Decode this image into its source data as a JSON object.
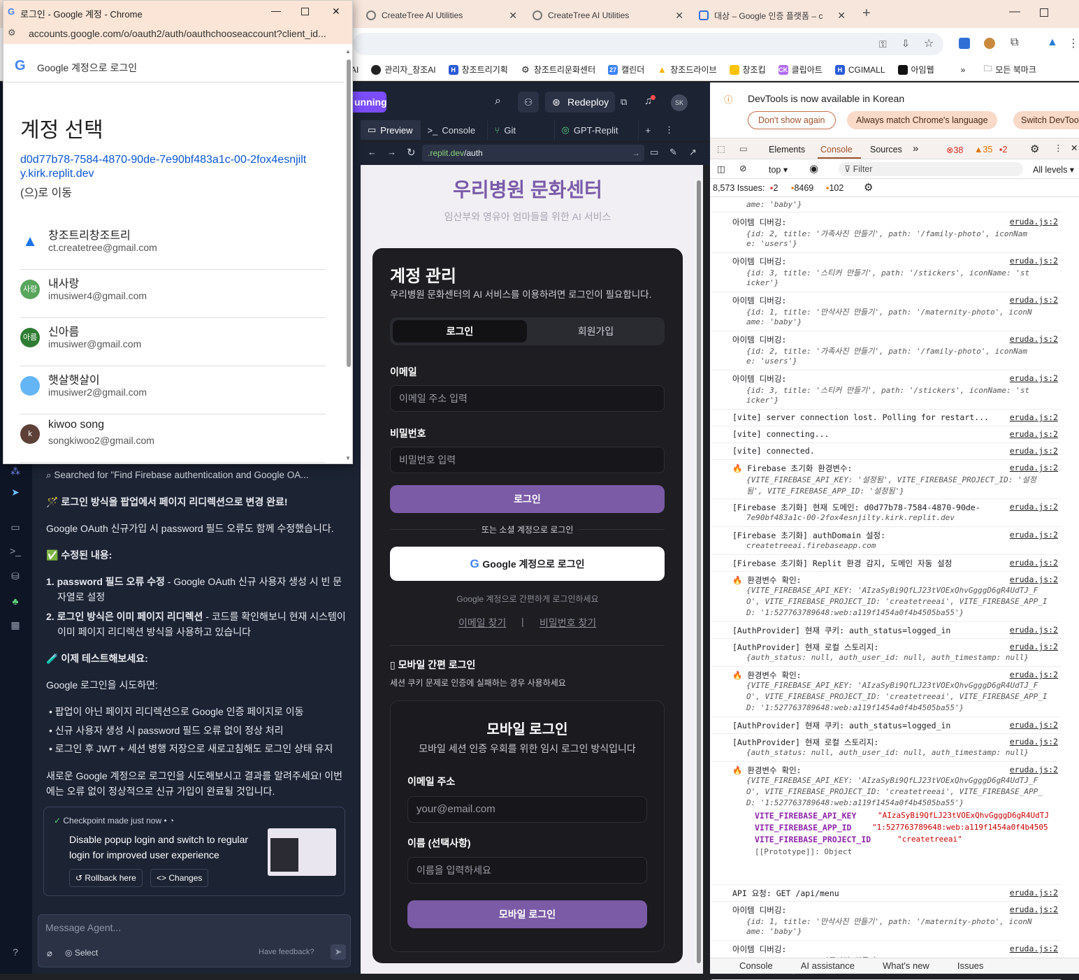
{
  "browser": {
    "tabs": [
      {
        "title": "CreateTree AI Utilities"
      },
      {
        "title": "CreateTree AI Utilities"
      },
      {
        "title": "대상 – Google 인증 플랫폼 – c"
      }
    ],
    "bookmarks": [
      "AI",
      "관리자_창조AI",
      "창조트리기획",
      "창조트리문화센터",
      "캘린더",
      "창조드라이브",
      "창조킵",
      "클립아트",
      "CGIMALL",
      "아임웹"
    ],
    "bookmark_icons": [
      "",
      "G",
      "H",
      "⚙",
      "27",
      "▲",
      "●",
      "CK",
      "H",
      "◼"
    ],
    "all_bookmarks": "모든 북마크",
    "more": "»"
  },
  "popup": {
    "window_title": "로그인 - Google 계정 - Chrome",
    "url": "accounts.google.com/o/oauth2/auth/oauthchooseaccount?client_id...",
    "header": "Google 계정으로 로그인",
    "heading": "계정 선택",
    "redirect_link": "d0d77b78-7584-4870-90de-7e90bf483a1c-00-2fox4esnjilty.kirk.replit.dev",
    "redirect_suffix": "(으)로 이동",
    "accounts": [
      {
        "name": "창조트리창조트리",
        "email": "ct.createtree@gmail.com",
        "avatar": "▲",
        "color": "#ffffff"
      },
      {
        "name": "내사랑",
        "email": "imusiwer4@gmail.com",
        "avatar": "사랑",
        "color": "#58a55c"
      },
      {
        "name": "신아름",
        "email": "imusiwer@gmail.com",
        "avatar": "아름",
        "color": "#2e7d32"
      },
      {
        "name": "햇살햇살이",
        "email": "imusiwer2@gmail.com",
        "avatar": "",
        "color": "#64b5f6"
      },
      {
        "name": "kiwoo song",
        "email": "songkiwoo2@gmail.com",
        "avatar": "k",
        "color": "#5d4037"
      }
    ]
  },
  "replit": {
    "run_label": "unning",
    "redeploy": "Redeploy",
    "avatar": "SK",
    "preview_tabs": [
      "Preview",
      "Console",
      "Git",
      "GPT-Replit"
    ],
    "url_domain": ".replit.dev",
    "url_path": "/auth",
    "chat": {
      "searched": "Searched for \"Find Firebase authentication and Google OA...",
      "heading1": "🪄 로그인 방식을 팝업에서 페이지 리디렉션으로 변경 완료!",
      "p1": "Google OAuth 신규가입 시 password 필드 오류도 함께 수정했습니다.",
      "fixed_heading": "✅ 수정된 내용:",
      "fix1_bold": "1. password 필드 오류 수정",
      "fix1_rest": " - Google OAuth 신규 사용자 생성 시 빈 문",
      "fix1_line2": "자열로 설정",
      "fix2_bold": "2. 로그인 방식은 이미 페이지 리디렉션",
      "fix2_rest": " - 코드를 확인해보니 현재 시스템이",
      "fix2_line2": "이미 페이지 리디렉션 방식을 사용하고 있습니다",
      "test_heading": "🧪 이제 테스트해보세요:",
      "p2": "Google 로그인을 시도하면:",
      "b1": "팝업이 아닌 페이지 리디렉션으로 Google 인증 페이지로 이동",
      "b2": "신규 사용자 생성 시 password 필드 오류 없이 정상 처리",
      "b3": "로그인 후 JWT + 세션 병행 저장으로 새로고침해도 로그인 상태 유지",
      "p3_line1": "새로운 Google 계정으로 로그인을 시도해보시고 결과를 알려주세요! 이번",
      "p3_line2": "에는 오류 없이 정상적으로 신규 가입이 완료될 것입니다.",
      "checkpoint_title": "Checkpoint made just now",
      "checkpoint_line1": "Disable popup login and switch to regular",
      "checkpoint_line2": "login for improved user experience",
      "rollback": "Rollback here",
      "changes": "Changes",
      "message_placeholder": "Message Agent...",
      "select": "Select",
      "feedback": "Have feedback?"
    }
  },
  "app": {
    "title": "우리병원 문화센터",
    "subtitle": "임산부와 영유아 엄마들을 위한 AI 서비스",
    "card_title": "계정 관리",
    "card_desc": "우리병원 문화센터의 AI 서비스를 이용하려면 로그인이 필요합니다.",
    "tab_login": "로그인",
    "tab_signup": "회원가입",
    "email_label": "이메일",
    "email_placeholder": "이메일 주소 입력",
    "password_label": "비밀번호",
    "password_placeholder": "비밀번호 입력",
    "login_button": "로그인",
    "or_social": "또는 소셜 계정으로 로그인",
    "google_button": "Google 계정으로 로그인",
    "google_hint": "Google 계정으로 간편하게 로그인하세요",
    "find_email": "이메일 찾기",
    "sep": "|",
    "find_password": "비밀번호 찾기",
    "mobile_section": "모바일 간편 로그인",
    "mobile_hint": "세션 쿠키 문제로 인증에 실패하는 경우 사용하세요",
    "mobile_title": "모바일 로그인",
    "mobile_desc": "모바일 세션 인증 우회를 위한 임시 로그인 방식입니다",
    "m_email_label": "이메일 주소",
    "m_email_placeholder": "your@email.com",
    "m_name_label": "이름 (선택사항)",
    "m_name_placeholder": "이름을 입력하세요",
    "m_button": "모바일 로그인"
  },
  "devtools": {
    "banner": "DevTools is now available in Korean",
    "btn_dont_show": "Don't show again",
    "btn_match": "Always match Chrome's language",
    "btn_switch": "Switch DevToo",
    "tabs": [
      "Elements",
      "Console",
      "Sources"
    ],
    "errors": "38",
    "warnings": "35",
    "issues_small": "2",
    "context": "top",
    "filter": "Filter",
    "levels": "All levels",
    "issues_label": "8,573 Issues:",
    "issue_err": "2",
    "issue_warn": "8469",
    "issue_info": "102",
    "bottom_tabs": [
      "Console",
      "AI assistance",
      "What's new",
      "Issues"
    ],
    "logs": [
      {
        "t": "아이템 디버깅:",
        "o1": "{id: 2, title: '가족사진 만들기', path: '/family-photo', iconNam",
        "o2": "e: 'users'}"
      },
      {
        "t": "아이템 디버깅:",
        "o1": "{id: 3, title: '스티커 만들기', path: '/stickers', iconName: 'st",
        "o2": "icker'}"
      },
      {
        "t": "아이템 디버깅:",
        "o1": "{id: 1, title: '만삭사진 만들기', path: '/maternity-photo', iconN",
        "o2": "ame: 'baby'}"
      },
      {
        "t": "아이템 디버깅:",
        "o1": "{id: 2, title: '가족사진 만들기', path: '/family-photo', iconNam",
        "o2": "e: 'users'}"
      },
      {
        "t": "아이템 디버깅:",
        "o1": "{id: 3, title: '스티커 만들기', path: '/stickers', iconName: 'st",
        "o2": "icker'}"
      },
      {
        "t": "[vite] server connection lost. Polling for restart...",
        "o1": "",
        "o2": ""
      },
      {
        "t": "[vite] connecting...",
        "o1": "",
        "o2": ""
      },
      {
        "t": "[vite] connected.",
        "o1": "",
        "o2": ""
      },
      {
        "t": "🔥 Firebase 초기화 환경변수:",
        "o1": "{VITE_FIREBASE_API_KEY: '설정됨', VITE_FIREBASE_PROJECT_ID: '설정",
        "o2": "됨', VITE_FIREBASE_APP_ID: '설정됨'}"
      },
      {
        "t": "[Firebase 초기화] 현재 도메인: d0d77b78-7584-4870-90de-",
        "o1": "7e90bf483a1c-00-2fox4esnjilty.kirk.replit.dev",
        "o2": ""
      },
      {
        "t": "[Firebase 초기화] authDomain 설정:",
        "o1": "createtreeai.firebaseapp.com",
        "o2": ""
      },
      {
        "t": "[Firebase 초기화] Replit 환경 감지, 도메인 자동 설정",
        "o1": "",
        "o2": ""
      },
      {
        "t": "🔥 환경변수 확인:",
        "o1": "{VITE_FIREBASE_API_KEY: 'AIzaSyBi9QfLJ23tVOExQhvGgggD6gR4UdTJ_F",
        "o2": "O', VITE_FIREBASE_PROJECT_ID: 'createtreeai', VITE_FIREBASE_APP_I",
        "o3": "D: '1:527763789648:web:a119f1454a0f4b4505ba55'}"
      },
      {
        "t": "[AuthProvider] 현재 쿠키: auth_status=logged_in",
        "o1": "",
        "o2": ""
      },
      {
        "t": "[AuthProvider] 현재 로컬 스토리지:",
        "o1": "{auth_status: null, auth_user_id: null, auth_timestamp: null}",
        "o2": ""
      },
      {
        "t": "🔥 환경변수 확인:",
        "o1": "{VITE_FIREBASE_API_KEY: 'AIzaSyBi9QfLJ23tVOExQhvGgggD6gR4UdTJ_F",
        "o2": "O', VITE_FIREBASE_PROJECT_ID: 'createtreeai', VITE_FIREBASE_APP_I",
        "o3": "D: '1:527763789648:web:a119f1454a0f4b4505ba55'}"
      },
      {
        "t": "[AuthProvider] 현재 쿠키: auth_status=logged_in",
        "o1": "",
        "o2": ""
      },
      {
        "t": "[AuthProvider] 현재 로컬 스토리지:",
        "o1": "{auth_status: null, auth_user_id: null, auth_timestamp: null}",
        "o2": ""
      },
      {
        "t": "🔥 환경변수 확인:",
        "o1": "{VITE_FIREBASE_API_KEY: 'AIzaSyBi9QfLJ23tVOExQhvGgggD6gR4UdTJ_F",
        "o2": "O', VITE_FIREBASE_PROJECT_ID: 'createtreeai', VITE_FIREBASE_APP_",
        "o3": "D: '1:527763789648:web:a119f1454a0f4b4505ba55'}"
      },
      {
        "t": "API 요청: GET /api/menu",
        "o1": "",
        "o2": ""
      },
      {
        "t": "아이템 디버깅:",
        "o1": "{id: 1, title: '만삭사진 만들기', path: '/maternity-photo', iconN",
        "o2": "ame: 'baby'}"
      },
      {
        "t": "아이템 디버깅:",
        "o1": "{id: 2, title: '가족사진 만들기', path: '/family-photo', iconNam",
        "o2": "e: 'users'}"
      }
    ],
    "top_partial": "ame: 'baby'}",
    "expanded": {
      "k1": "VITE_FIREBASE_API_KEY",
      "v1": "\"AIzaSyBi9QfLJ23tVOExQhvGgggD6gR4UdTJ",
      "k2": "VITE_FIREBASE_APP_ID",
      "v2": "\"1:527763789648:web:a119f1454a0f4b4505",
      "k3": "VITE_FIREBASE_PROJECT_ID",
      "v3": "\"createtreeai\"",
      "proto": "[[Prototype]]: Object"
    },
    "source": "eruda.js:2"
  }
}
